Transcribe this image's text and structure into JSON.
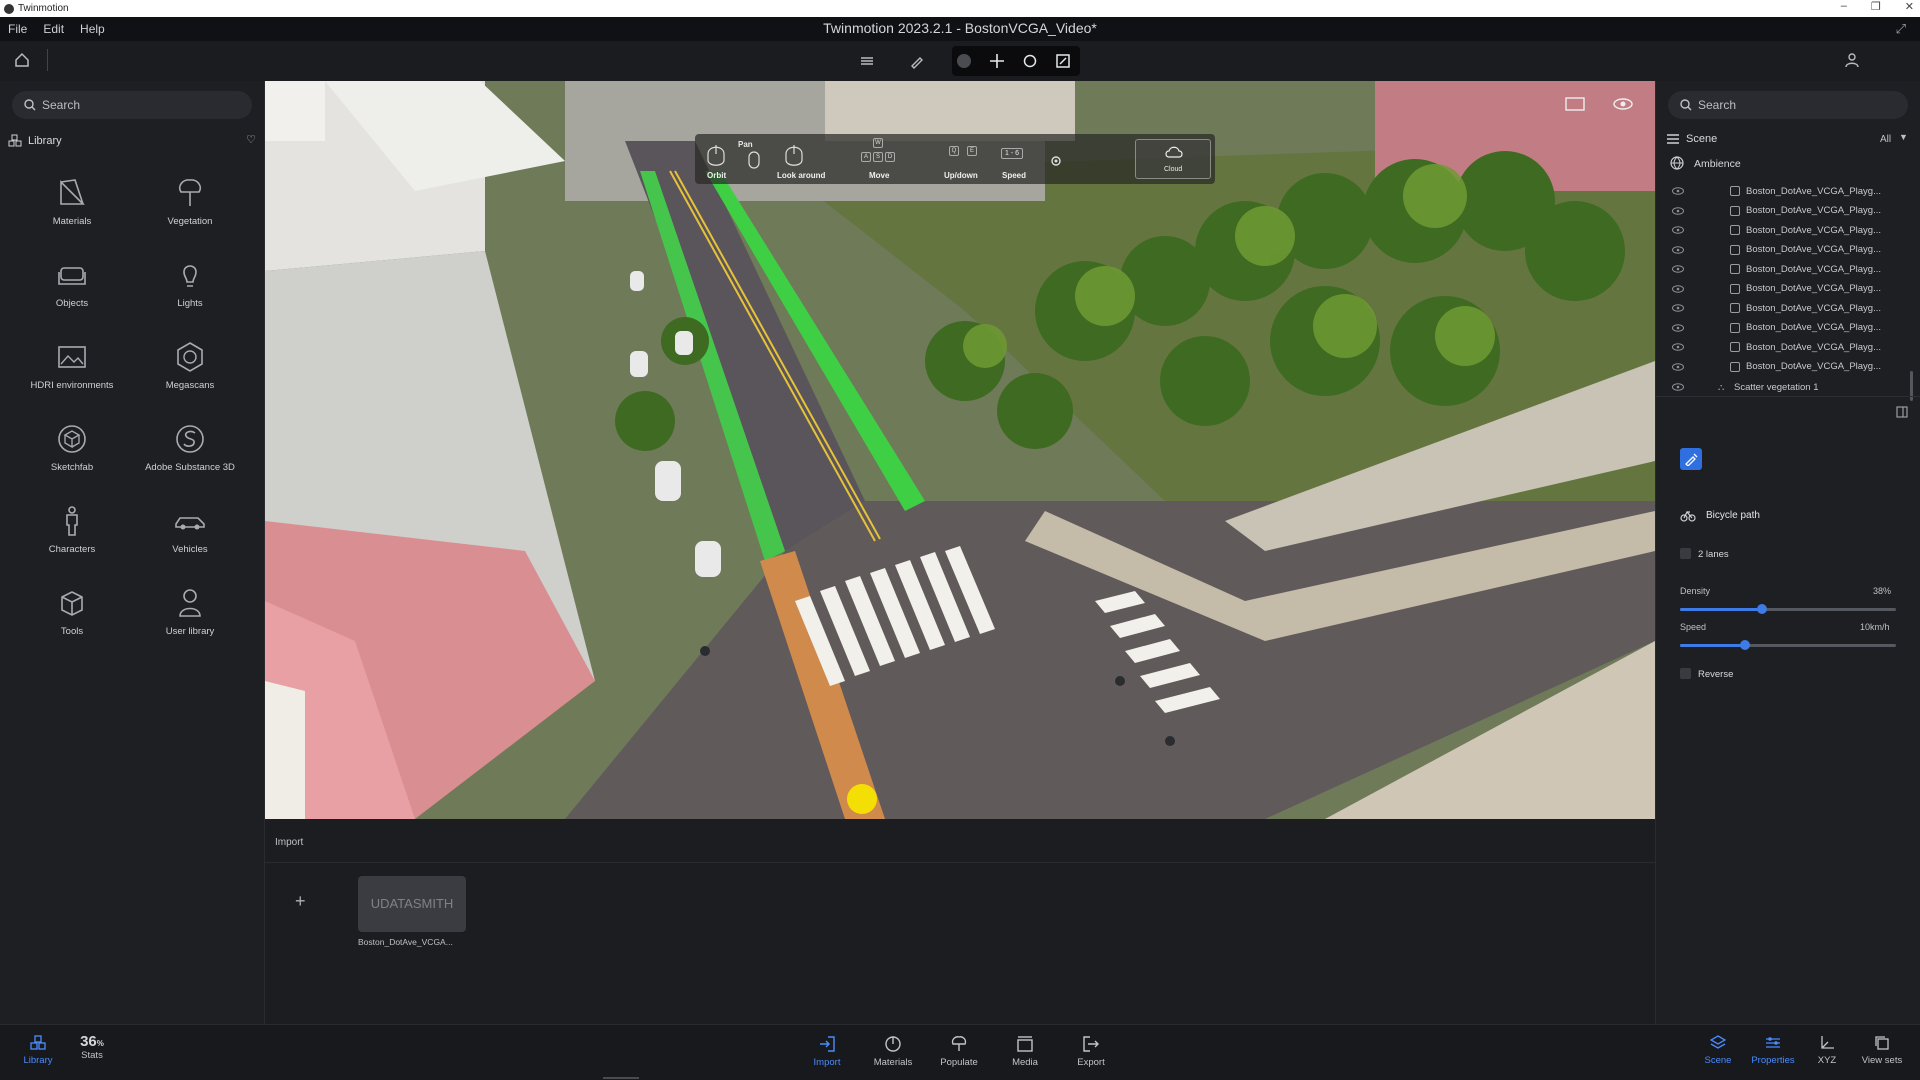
{
  "os_window": {
    "title": "Twinmotion",
    "buttons": [
      "–",
      "❐",
      "✕"
    ]
  },
  "menu": [
    "File",
    "Edit",
    "Help"
  ],
  "app_title": "Twinmotion 2023.2.1 - BostonVCGA_Video*",
  "left": {
    "search_placeholder": "Search",
    "library_title": "Library",
    "items": [
      "Materials",
      "Vegetation",
      "Objects",
      "Lights",
      "HDRI environments",
      "Megascans",
      "Sketchfab",
      "Adobe Substance 3D",
      "Characters",
      "Vehicles",
      "Tools",
      "User library"
    ]
  },
  "nav_overlay": {
    "pan": "Pan",
    "orbit": "Orbit",
    "look_around": "Look around",
    "move": "Move",
    "updown": "Up/down",
    "speed": "Speed",
    "speed_value": "1 - 6",
    "cloud": "Cloud",
    "keys_move": [
      "W",
      "A",
      "S",
      "D"
    ],
    "keys_updown": [
      "Q",
      "E"
    ]
  },
  "right": {
    "search_placeholder": "Search",
    "scene_label": "Scene",
    "filter": "All",
    "ambience": "Ambience",
    "tree_items": [
      "Boston_DotAve_VCGA_Playg...",
      "Boston_DotAve_VCGA_Playg...",
      "Boston_DotAve_VCGA_Playg...",
      "Boston_DotAve_VCGA_Playg...",
      "Boston_DotAve_VCGA_Playg...",
      "Boston_DotAve_VCGA_Playg...",
      "Boston_DotAve_VCGA_Playg...",
      "Boston_DotAve_VCGA_Playg...",
      "Boston_DotAve_VCGA_Playg...",
      "Boston_DotAve_VCGA_Playg..."
    ],
    "scatter": "Scatter vegetation 1",
    "props": {
      "title": "Bicycle path",
      "two_lanes": "2 lanes",
      "density_label": "Density",
      "density_value": "38%",
      "density_fraction": 0.38,
      "speed_label": "Speed",
      "speed_value": "10km/h",
      "speed_fraction": 0.3,
      "reverse": "Reverse"
    }
  },
  "import": {
    "header": "Import",
    "add": "+",
    "asset_thumb": "UDATASMITH",
    "asset_name": "Boston_DotAve_VCGA..."
  },
  "bottom": {
    "library": "Library",
    "stats_value": "36",
    "stats_unit": "%",
    "stats": "Stats",
    "import": "Import",
    "materials": "Materials",
    "populate": "Populate",
    "media": "Media",
    "export": "Export",
    "scene": "Scene",
    "properties": "Properties",
    "xyz": "XYZ",
    "view_sets": "View sets"
  },
  "colors": {
    "accent": "#4a8cff",
    "bike_lane": "#35d04a",
    "building_pink": "#d98e91"
  }
}
